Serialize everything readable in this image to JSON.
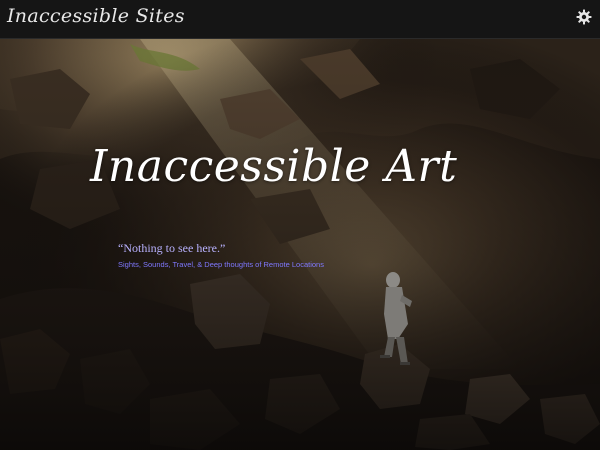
{
  "header": {
    "site_title": "Inaccessible Sites",
    "settings_icon": "gear-icon"
  },
  "hero": {
    "title": "Inaccessible Art",
    "quote": "“Nothing to see here.”",
    "subtitle": "Sights, Sounds, Travel, & Deep thoughts of Remote Locations",
    "image": "cave-explorer-photo"
  },
  "colors": {
    "topbar_bg": "#151515",
    "quote": "#b9b2ff",
    "subtitle": "#7f78ff",
    "title": "#ffffff"
  }
}
